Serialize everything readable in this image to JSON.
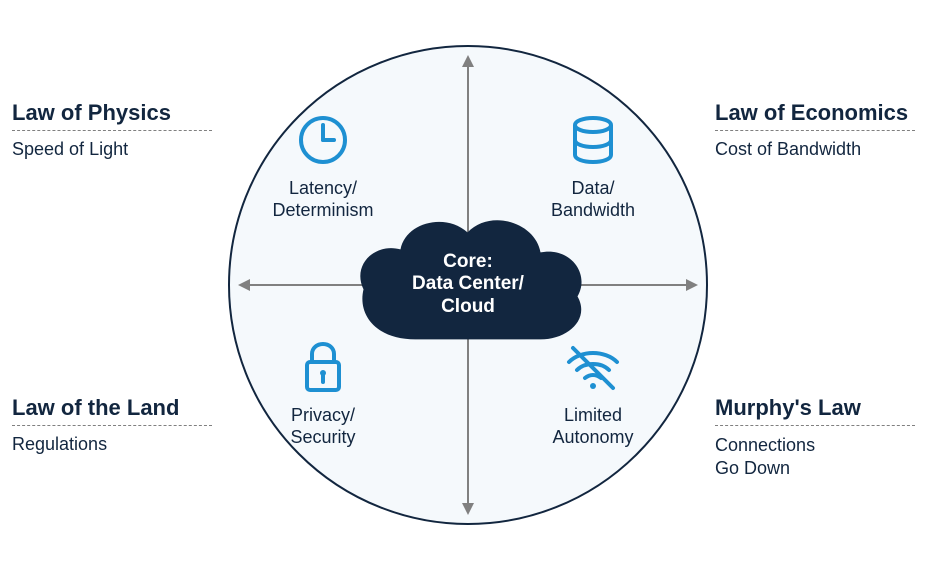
{
  "core": {
    "line1": "Core:",
    "line2": "Data Center/",
    "line3": "Cloud"
  },
  "quadrants": {
    "topLeft": {
      "label1": "Latency/",
      "label2": "Determinism"
    },
    "topRight": {
      "label1": "Data/",
      "label2": "Bandwidth"
    },
    "botLeft": {
      "label1": "Privacy/",
      "label2": "Security"
    },
    "botRight": {
      "label1": "Limited",
      "label2": "Autonomy"
    }
  },
  "outer": {
    "topLeft": {
      "title": "Law of Physics",
      "sub": "Speed of Light"
    },
    "topRight": {
      "title": "Law of Economics",
      "sub": "Cost of Bandwidth"
    },
    "botLeft": {
      "title": "Law of the Land",
      "sub": "Regulations"
    },
    "botRight": {
      "title": "Murphy's Law",
      "sub1": "Connections",
      "sub2": "Go Down"
    }
  },
  "colors": {
    "accent": "#1E90D2",
    "dark": "#12263F",
    "arrow": "#808080"
  }
}
